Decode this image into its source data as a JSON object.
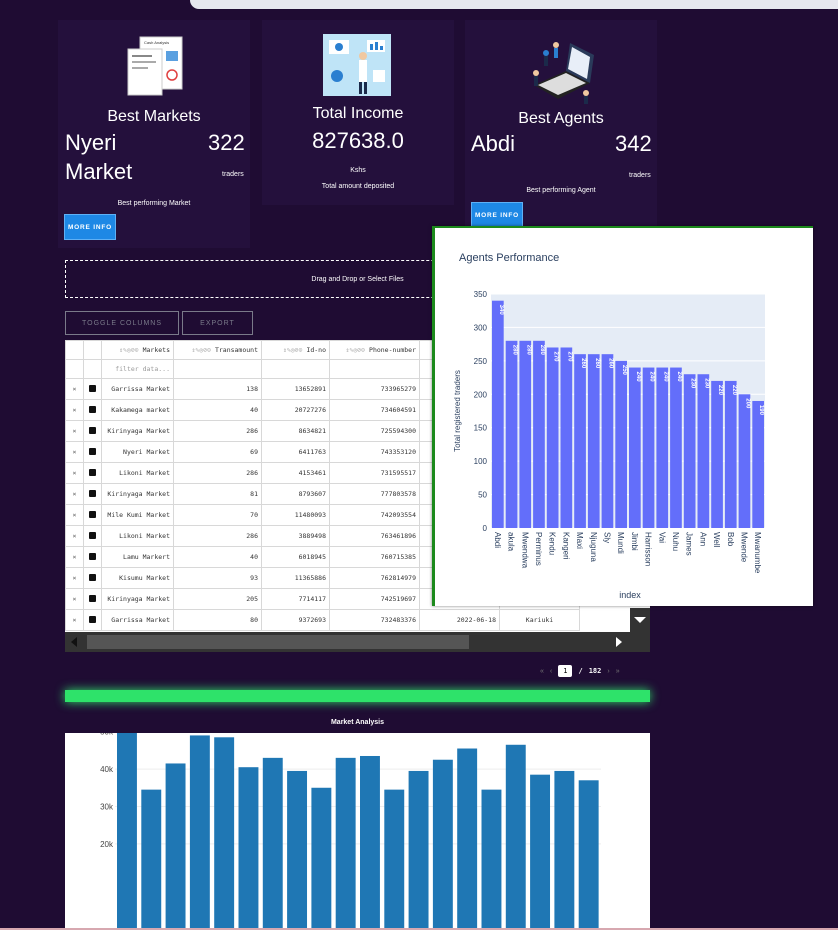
{
  "cards": [
    {
      "icon": "cash-analysis-icon",
      "title": "Best Markets",
      "name_line1": "Nyeri",
      "name_line2": "Market",
      "count": "322",
      "count_unit": "traders",
      "caption": "Best performing Market",
      "button": "MORE INFO"
    },
    {
      "icon": "income-analytics-icon",
      "title": "Total Income",
      "value": "827638.0",
      "unit": "Kshs",
      "caption": "Total amount deposited"
    },
    {
      "icon": "agents-laptop-icon",
      "title": "Best Agents",
      "name_line1": "Abdi",
      "count": "342",
      "count_unit": "traders",
      "caption": "Best performing Agent",
      "button": "MORE INFO"
    }
  ],
  "upload": {
    "label": "Drag and Drop or Select Files"
  },
  "toolbar": {
    "toggle_columns": "TOGGLE COLUMNS",
    "export": "EXPORT"
  },
  "table": {
    "columns": [
      "Markets",
      "Transamount",
      "Id-no",
      "Phone-number"
    ],
    "filter_placeholder": "filter data...",
    "rows": [
      [
        "Garrissa Market",
        "138",
        "13652891",
        "733965279"
      ],
      [
        "Kakamega market",
        "40",
        "20727276",
        "734604591"
      ],
      [
        "Kirinyaga Market",
        "286",
        "8634821",
        "725594300"
      ],
      [
        "Nyeri Market",
        "69",
        "6411763",
        "743353120"
      ],
      [
        "Likoni Market",
        "286",
        "4153461",
        "731595517"
      ],
      [
        "Kirinyaga Market",
        "81",
        "8793607",
        "777803578"
      ],
      [
        "Mile Kumi Market",
        "70",
        "11480093",
        "742093554"
      ],
      [
        "Likoni Market",
        "286",
        "3889498",
        "763461896"
      ],
      [
        "Lamu Markert",
        "40",
        "6018945",
        "760715385"
      ],
      [
        "Kisumu Market",
        "93",
        "11365886",
        "762814979"
      ],
      [
        "Kirinyaga Market",
        "205",
        "7714117",
        "742519697"
      ],
      [
        "Garrissa Market",
        "80",
        "9372693",
        "732483376"
      ]
    ],
    "last_row_extra": {
      "date": "2022-06-18",
      "agent": "Kariuki"
    },
    "delete_symbol": "×"
  },
  "pagination": {
    "first": "«",
    "prev": "‹",
    "current": "1",
    "separator": "/",
    "total": "182",
    "next": "›",
    "last": "»"
  },
  "market_analysis": {
    "title": "Market Analysis",
    "chart_data": {
      "type": "bar",
      "title": "Market Analysis",
      "yticks": [
        "20k",
        "30k",
        "40k",
        "50k"
      ],
      "values": [
        52500,
        34500,
        41500,
        49000,
        48500,
        40500,
        43000,
        39500,
        35000,
        43000,
        43500,
        34500,
        39500,
        42500,
        45500,
        34500,
        46500,
        38500,
        39500,
        37000
      ],
      "ylim": [
        13000,
        55000
      ],
      "color": "#1f77b4"
    }
  },
  "agents_popup": {
    "title": "Agents Performance",
    "chart_data": {
      "type": "bar",
      "title": "Agents Performance",
      "xlabel": "index",
      "ylabel": "Total registered traders",
      "categories": [
        "Abdi",
        "akula",
        "Mwendwa",
        "Perminus",
        "Kendu",
        "Kangeri",
        "Maxi",
        "Njuguna",
        "Sly",
        "Mundi",
        "Jimbi",
        "Harrisson",
        "Vai",
        "Nuhu",
        "James",
        "Ann",
        "Well",
        "Bob",
        "Mwende",
        "Mwanumbe"
      ],
      "values": [
        340,
        280,
        280,
        280,
        270,
        270,
        260,
        260,
        260,
        250,
        240,
        240,
        240,
        240,
        230,
        230,
        220,
        220,
        200,
        190
      ],
      "ylim": [
        0,
        350
      ],
      "yticks": [
        0,
        50,
        100,
        150,
        200,
        250,
        300,
        350
      ],
      "color": "#636efa"
    }
  }
}
